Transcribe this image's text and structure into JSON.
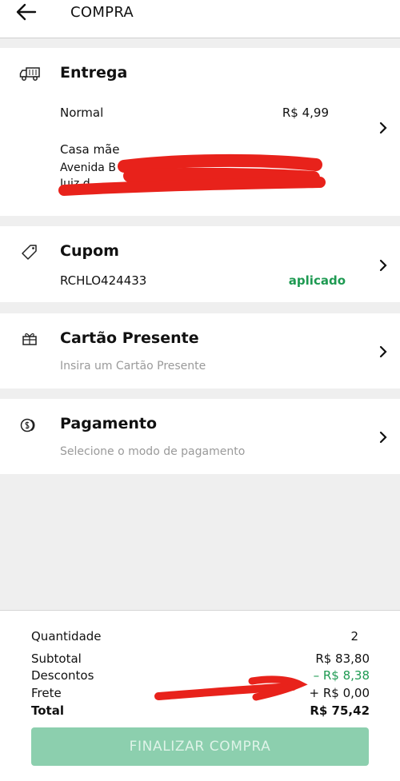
{
  "header": {
    "title": "COMPRA"
  },
  "entrega": {
    "title": "Entrega",
    "method": "Normal",
    "price": "R$ 4,99",
    "address_label": "Casa mãe",
    "address_line1": "Avenida B",
    "address_line2": "Juiz d"
  },
  "cupom": {
    "title": "Cupom",
    "code": "RCHLO424433",
    "status": "aplicado"
  },
  "presente": {
    "title": "Cartão Presente",
    "hint": "Insira um Cartão Presente"
  },
  "pagamento": {
    "title": "Pagamento",
    "hint": "Selecione o modo de pagamento"
  },
  "summary": {
    "quantidade_label": "Quantidade",
    "quantidade_value": "2",
    "subtotal_label": "Subtotal",
    "subtotal_value": "R$ 83,80",
    "descontos_label": "Descontos",
    "descontos_value": "– R$ 8,38",
    "frete_label": "Frete",
    "frete_value": "+ R$ 0,00",
    "total_label": "Total",
    "total_value": "R$ 75,42"
  },
  "finalize_button": "FINALIZAR COMPRA",
  "colors": {
    "accent_green": "#1e9a52",
    "button_disabled": "#8ccfae",
    "redaction": "#e8221b"
  }
}
